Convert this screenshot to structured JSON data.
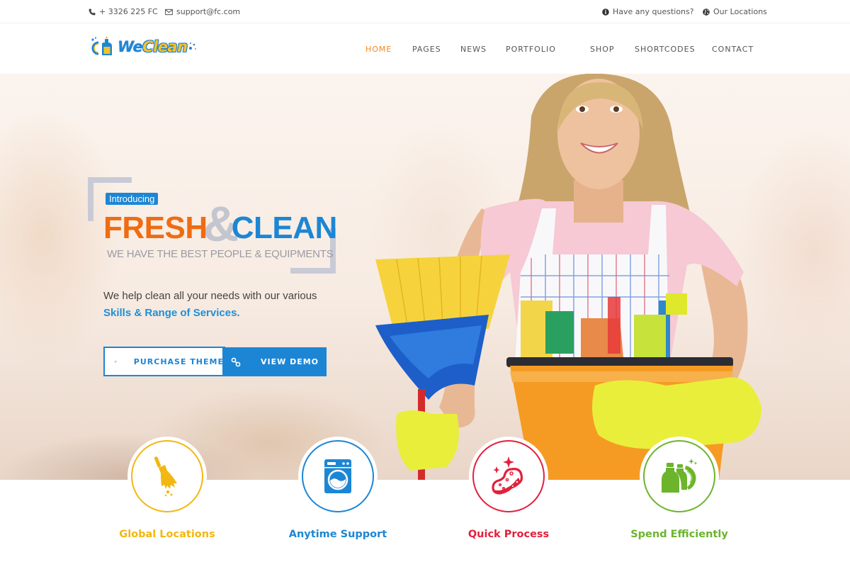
{
  "topbar": {
    "phone": "+ 3326 225 FC",
    "email": "support@fc.com",
    "questions": "Have any questions?",
    "locations": "Our Locations"
  },
  "header": {
    "logo_we": "We",
    "logo_clean": "Clean",
    "nav": [
      {
        "label": "HOME",
        "active": true
      },
      {
        "label": "PAGES",
        "active": false
      },
      {
        "label": "NEWS",
        "active": false
      },
      {
        "label": "PORTFOLIO",
        "active": false
      },
      {
        "label": "SHOP",
        "active": false
      },
      {
        "label": "SHORTCODES",
        "active": false
      },
      {
        "label": "CONTACT",
        "active": false
      }
    ]
  },
  "hero": {
    "badge": "Introducing",
    "headline_1": "FRESH",
    "headline_amp": "&",
    "headline_2": "CLEAN",
    "tagline": "WE HAVE THE BEST PEOPLE & EQUIPMENTS",
    "description": "We help clean all your needs with our various",
    "description_strong": "Skills & Range of Services.",
    "buttons": {
      "purchase": "PURCHASE THEME",
      "demo": "VIEW DEMO"
    }
  },
  "features": [
    {
      "title": "Global Locations",
      "icon": "broom-icon",
      "color": "#f3b712"
    },
    {
      "title": "Anytime Support",
      "icon": "washing-machine-icon",
      "color": "#1d86d4"
    },
    {
      "title": "Quick Process",
      "icon": "sponge-icon",
      "color": "#e2203c"
    },
    {
      "title": "Spend Efficiently",
      "icon": "cleaning-bottles-icon",
      "color": "#6cb42c"
    }
  ],
  "colors": {
    "accent_orange": "#ef6c12",
    "accent_blue": "#1d86d4",
    "nav_active": "#f08a24"
  }
}
